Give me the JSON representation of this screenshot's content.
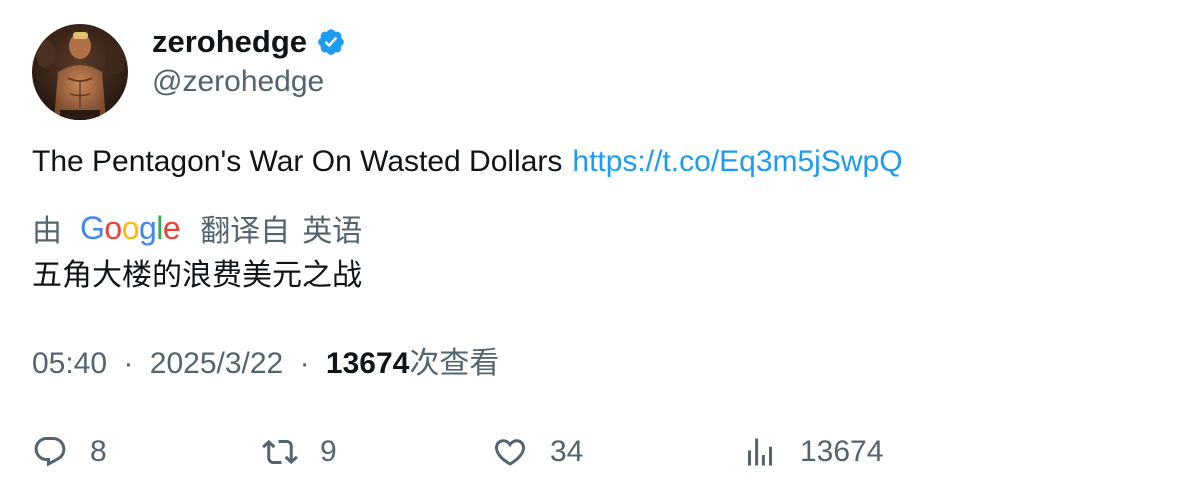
{
  "author": {
    "display_name": "zerohedge",
    "handle": "@zerohedge",
    "verified": true,
    "verified_color": "#1d9bf0"
  },
  "tweet": {
    "text": "The Pentagon's War On Wasted Dollars",
    "link": "https://t.co/Eq3m5jSwpQ",
    "link_color": "#1d9bf0"
  },
  "translation": {
    "by_label": "由",
    "provider": "Google",
    "translated_from_label": "翻译自",
    "source_language": "英语",
    "translated_text": "五角大楼的浪费美元之战"
  },
  "meta": {
    "time": "05:40",
    "separator": "·",
    "date": "2025/3/22",
    "views_count": "13674",
    "views_label": "次查看"
  },
  "actions": {
    "replies": "8",
    "retweets": "9",
    "likes": "34",
    "views": "13674",
    "icons": [
      "reply-icon",
      "retweet-icon",
      "like-icon",
      "views-icon"
    ]
  }
}
